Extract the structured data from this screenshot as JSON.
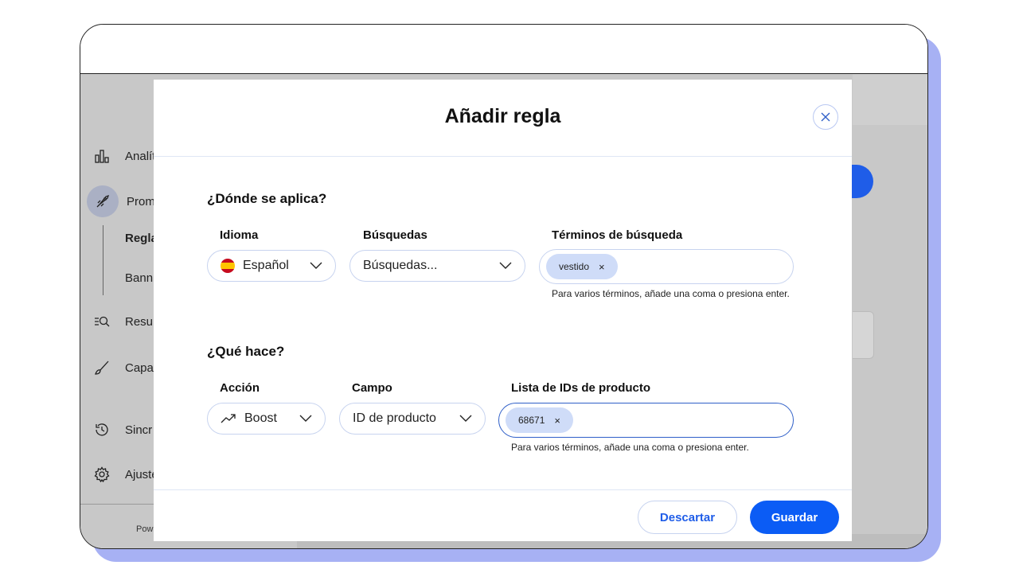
{
  "sidebar": {
    "items": [
      {
        "label": "Analít",
        "icon": "bar-chart-icon"
      },
      {
        "label": "Prom",
        "icon": "rocket-icon"
      },
      {
        "label": "Resul",
        "icon": "search-list-icon"
      },
      {
        "label": "Capa",
        "icon": "brush-icon"
      },
      {
        "label": "Sincr",
        "icon": "history-icon"
      },
      {
        "label": "Ajuste",
        "icon": "gear-icon"
      }
    ],
    "sub_items": [
      "Regla",
      "Bann"
    ],
    "footer": "Pow"
  },
  "modal": {
    "title": "Añadir regla",
    "where": {
      "title": "¿Dónde se aplica?",
      "language_label": "Idioma",
      "language_value": "Español",
      "searches_label": "Búsquedas",
      "searches_value": "Búsquedas...",
      "terms_label": "Términos de búsqueda",
      "terms_chip": "vestido",
      "terms_help": "Para varios términos, añade una coma o presiona enter."
    },
    "what": {
      "title": "¿Qué hace?",
      "action_label": "Acción",
      "action_value": "Boost",
      "field_label": "Campo",
      "field_value": "ID de producto",
      "ids_label": "Lista de IDs de producto",
      "ids_chip": "68671",
      "ids_help": "Para varios términos, añade una coma o presiona enter."
    },
    "buttons": {
      "discard": "Descartar",
      "save": "Guardar"
    },
    "chip_remove": "×"
  },
  "colors": {
    "accent": "#0b5cf5",
    "device_shadow": "#a7b1f4",
    "chip_bg": "#cfdcf8"
  }
}
